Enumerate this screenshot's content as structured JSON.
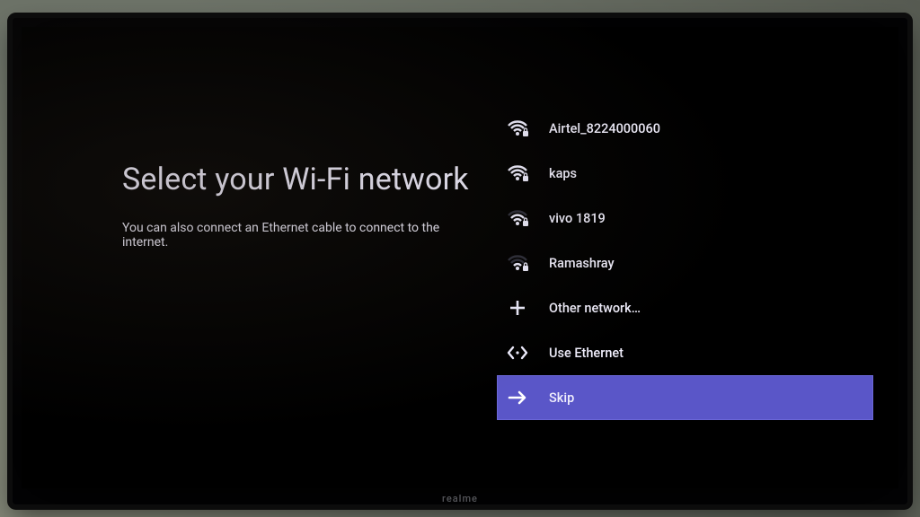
{
  "brand": "realme",
  "heading": "Select your Wi-Fi network",
  "subtitle": "You can also connect an Ethernet cable to connect to the internet.",
  "networks": [
    {
      "ssid": "Airtel_8224000060",
      "signal": "full",
      "secured": true
    },
    {
      "ssid": "kaps",
      "signal": "full",
      "secured": true
    },
    {
      "ssid": "vivo 1819",
      "signal": "mid",
      "secured": true
    },
    {
      "ssid": "Ramashray",
      "signal": "low",
      "secured": true
    }
  ],
  "other_network_label": "Other network…",
  "use_ethernet_label": "Use Ethernet",
  "skip_label": "Skip",
  "selected_row": "skip",
  "colors": {
    "accent": "#5a56c8"
  }
}
